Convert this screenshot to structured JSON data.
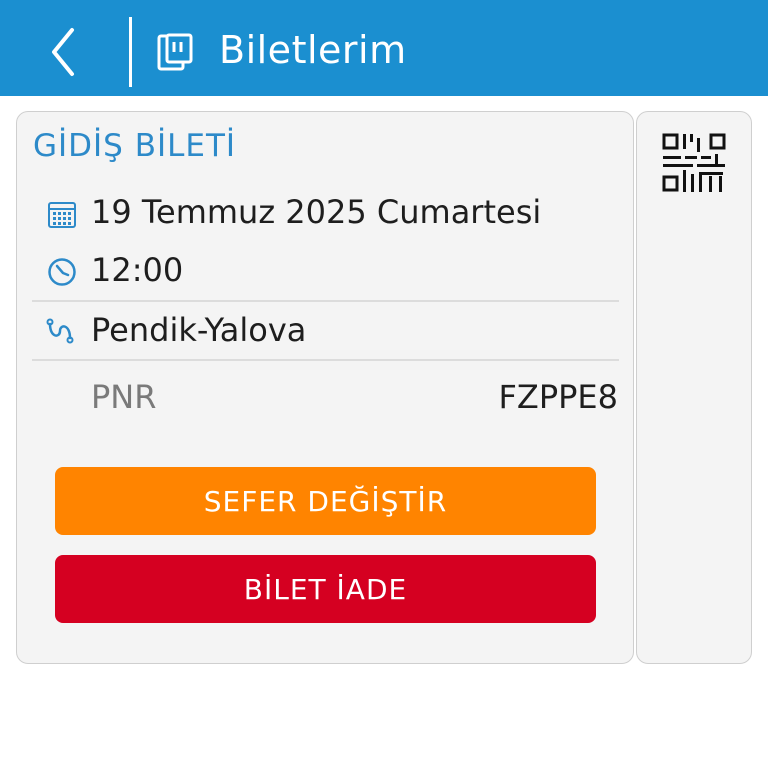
{
  "header": {
    "title": "Biletlerim",
    "back_icon": "chevron-left-icon",
    "ticket_icon": "ticket-icon",
    "background_color": "#1b8fd0"
  },
  "ticket": {
    "heading": "GİDİŞ BİLETİ",
    "date": "19 Temmuz 2025 Cumartesi",
    "time": "12:00",
    "route": "Pendik-Yalova",
    "pnr_label": "PNR",
    "pnr_value": "FZPPE8",
    "date_icon": "calendar-icon",
    "time_icon": "clock-icon",
    "route_icon": "route-icon",
    "heading_color": "#2d8ac9"
  },
  "actions": {
    "change_trip": "SEFER DEĞİŞTİR",
    "refund_ticket": "BİLET İADE",
    "change_trip_color": "#ff8400",
    "refund_color": "#d50021"
  },
  "qr": {
    "icon": "qr-code-icon"
  }
}
